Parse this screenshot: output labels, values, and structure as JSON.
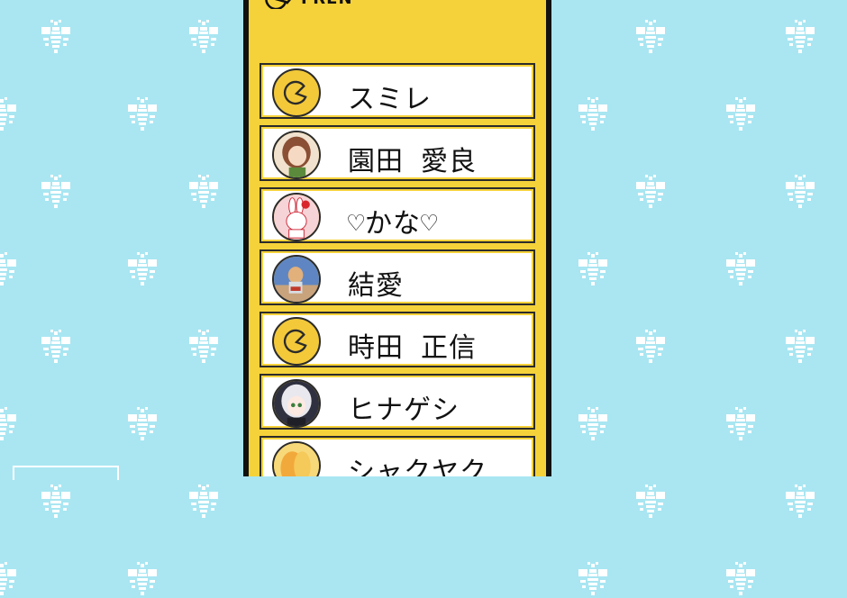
{
  "header": {
    "title": "FREN",
    "icon": "pacman-icon"
  },
  "friends": [
    {
      "name": "スミレ",
      "avatar": "pacman-icon",
      "avatar_color": "#f3c93a"
    },
    {
      "name": "園田 愛良",
      "avatar": "girl-avatar",
      "avatar_color": "#e9c9a7"
    },
    {
      "name": "♡かな♡",
      "avatar": "bunny-avatar",
      "avatar_color": "#f6d3d6"
    },
    {
      "name": "結愛",
      "avatar": "photo-avatar",
      "avatar_color": "#5f86c3"
    },
    {
      "name": "時田 正信",
      "avatar": "pacman-icon",
      "avatar_color": "#f3c93a"
    },
    {
      "name": "ヒナゲシ",
      "avatar": "anime-avatar",
      "avatar_color": "#cfcfd8"
    },
    {
      "name": "シャクヤク",
      "avatar": "fruit-avatar",
      "avatar_color": "#f2b84b"
    }
  ],
  "colors": {
    "background": "#a9e6f2",
    "panel": "#f6d23a",
    "pattern": "#ffffff"
  }
}
